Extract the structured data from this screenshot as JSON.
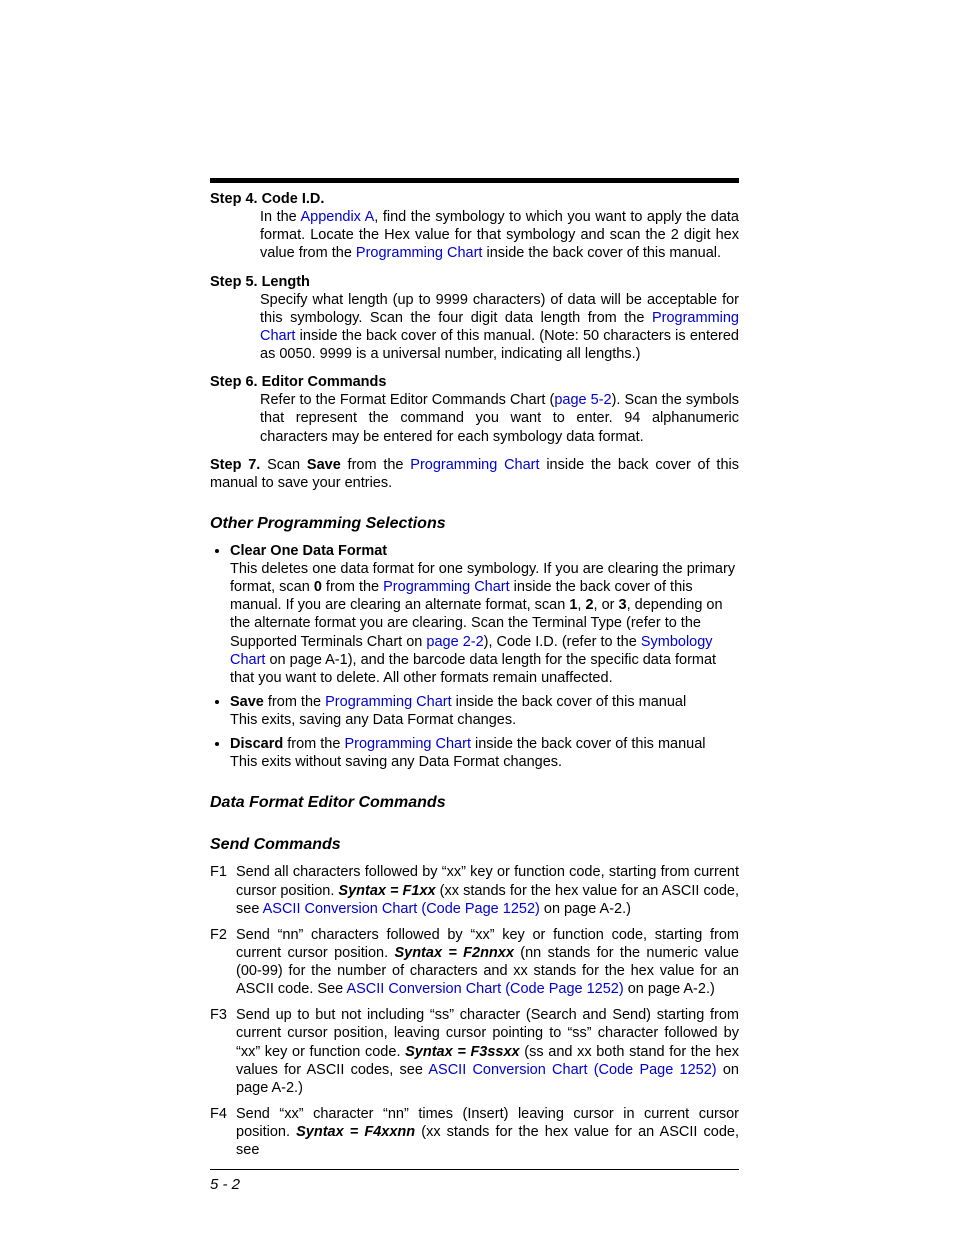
{
  "steps": {
    "s4": {
      "label": "Step 4.  Code I.D.",
      "t1": "In the  ",
      "l1": "Appendix A",
      "t2": ", find the symbology to which you want to apply the data format.  Locate the Hex value for that symbology and scan the 2 digit hex value from the ",
      "l2": "Programming Chart",
      "t3": " inside the back cover of this manual."
    },
    "s5": {
      "label": "Step 5.  Length",
      "t1": "Specify what length (up to 9999 characters) of data will be acceptable for this symbology.  Scan the four digit data length from the ",
      "l1": "Programming Chart",
      "t2": " inside the back cover of this manual.  (Note: 50 characters is entered as 0050.  9999 is a universal number, indicating all lengths.)"
    },
    "s6": {
      "label": "Step 6.  Editor Commands",
      "t1": "Refer to the Format Editor Commands Chart (",
      "l1": "page 5-2",
      "t2": ").  Scan the symbols that represent the command you want to enter.  94 alphanumeric characters may be entered for each symbology data format."
    },
    "s7": {
      "label": "Step 7.",
      "t1": "  Scan ",
      "b1": "Save",
      "t2": " from the ",
      "l1": "Programming Chart",
      "t3": " inside the back cover of this manual to save your entries."
    }
  },
  "headings": {
    "other": "Other Programming Selections",
    "dfec": "Data Format Editor Commands",
    "send": "Send Commands"
  },
  "other": {
    "i1": {
      "b1": "Clear One Data Format",
      "t1": "This deletes one data format for one symbology.   If you are clearing the primary format, scan ",
      "b2": "0",
      "t2": " from the ",
      "l1": "Programming Chart",
      "t3": " inside the back cover of this manual.  If you are clearing an alternate format, scan ",
      "b3": "1",
      "t4": ", ",
      "b4": "2",
      "t5": ", or ",
      "b5": "3",
      "t6": ", depending on the alternate format you are clearing.  Scan the Terminal Type (refer to the Supported Terminals Chart on ",
      "l2": "page 2-2",
      "t7": "), Code I.D. (refer to the ",
      "l3": "Symbology Chart",
      "t8": " on page A-1), and the barcode data length for the specific data format that you want to delete.  All other formats remain unaffected."
    },
    "i2": {
      "b1": "Save",
      "t1": " from the ",
      "l1": "Programming Chart",
      "t2": " inside the back cover of this manual",
      "t3": "This exits, saving any Data Format changes."
    },
    "i3": {
      "b1": "Discard",
      "t1": " from the ",
      "l1": "Programming Chart",
      "t2": " inside the back cover of this manual",
      "t3": "This exits without saving any Data Format changes."
    }
  },
  "send": {
    "f1": {
      "tag": "F1",
      "t1": "Send all characters followed by “xx” key or function code, starting from current cursor position.  ",
      "s1": "Syntax = F1xx",
      "t2": " (xx stands for the hex value for an ASCII code, see ",
      "l1": "ASCII Conversion Chart (Code Page 1252)",
      "t3": " on page A-2.)"
    },
    "f2": {
      "tag": "F2",
      "t1": "Send “nn” characters followed by “xx” key or function code, starting from current cursor position.  ",
      "s1": "Syntax = F2nnxx",
      "t2": " (nn stands for the numeric value (00-99) for the number of characters and xx stands for the hex value for an ASCII code.  See ",
      "l1": "ASCII Conversion Chart (Code Page 1252)",
      "t3": " on page A-2.)"
    },
    "f3": {
      "tag": "F3",
      "t1": "Send up to but not including “ss” character (Search and Send) starting from current cursor position, leaving cursor pointing to “ss” character followed by “xx” key or function code.  ",
      "s1": "Syntax = F3ssxx",
      "t2": " (ss and xx both stand for the hex values for ASCII codes, see ",
      "l1": "ASCII Conversion Chart (Code Page 1252)",
      "t3": " on page A-2.)"
    },
    "f4": {
      "tag": "F4",
      "t1": "Send “xx” character “nn” times (Insert) leaving cursor in current cursor position.  ",
      "s1": "Syntax = F4xxnn",
      "t2": " (xx stands for the hex value for an ASCII code, see "
    }
  },
  "pageNumber": "5 - 2"
}
